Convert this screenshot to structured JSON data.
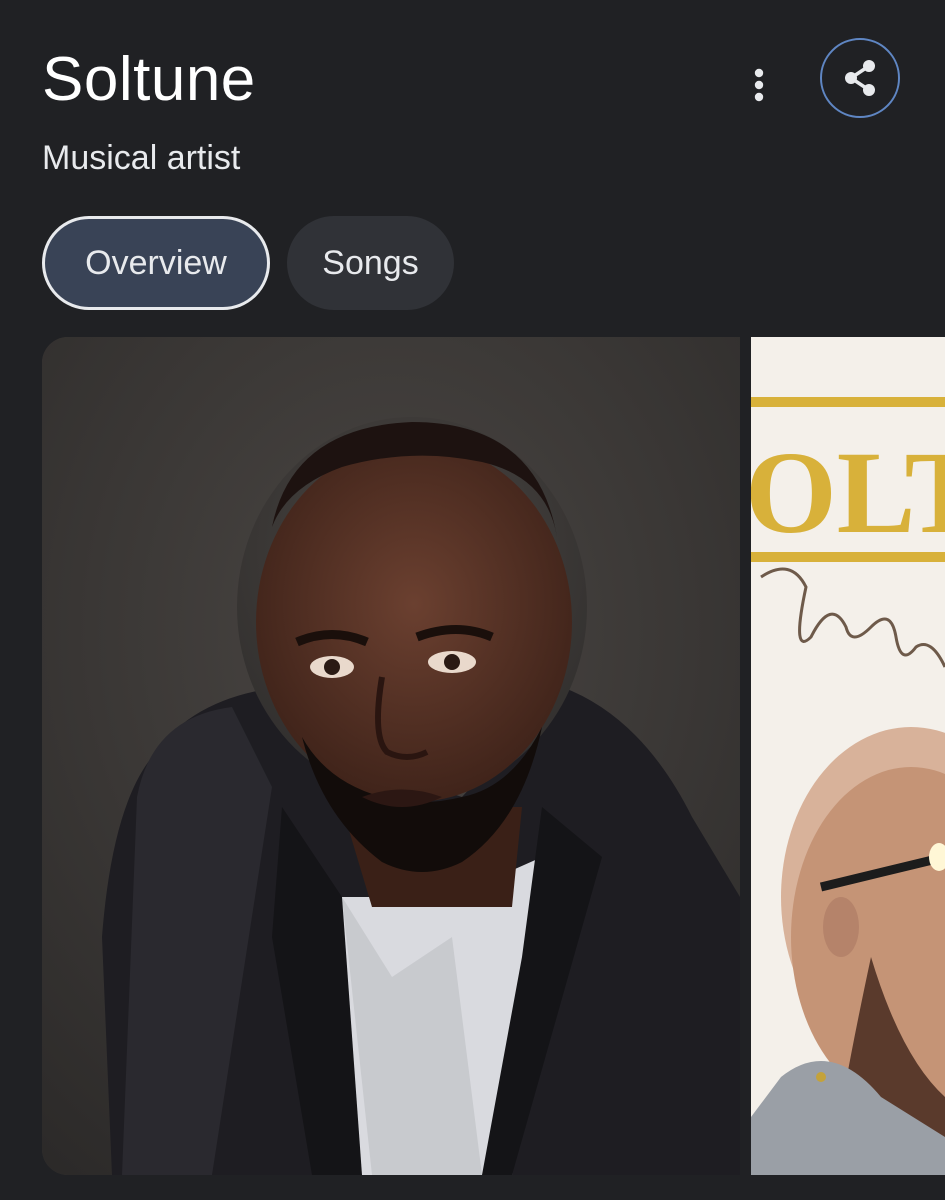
{
  "header": {
    "title": "Soltune",
    "subtitle": "Musical artist",
    "more_icon": "more-vert-icon",
    "share_icon": "share-icon"
  },
  "tabs": [
    {
      "label": "Overview",
      "selected": true
    },
    {
      "label": "Songs",
      "selected": false
    }
  ],
  "images": [
    {
      "description_icon": "artist-portrait-image"
    },
    {
      "description_icon": "album-cover-image",
      "cover_text": "OLT"
    }
  ],
  "colors": {
    "background": "#202124",
    "selected_tab": "#394356",
    "share_ring": "#5f86c3",
    "cover_gold": "#d8b13a"
  }
}
